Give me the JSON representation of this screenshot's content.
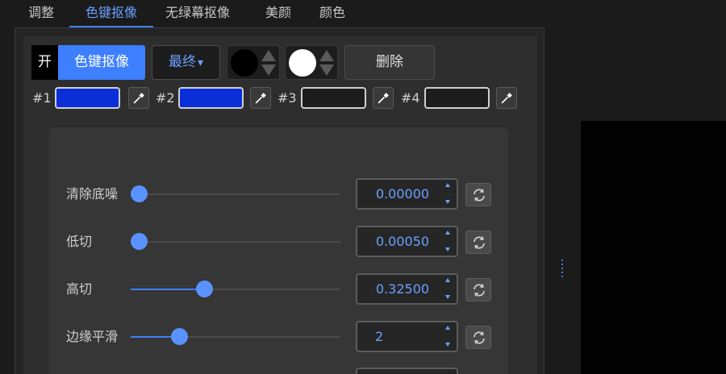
{
  "tabs": [
    {
      "label": "调整"
    },
    {
      "label": "色键抠像"
    },
    {
      "label": "无绿幕抠像"
    },
    {
      "label": "美颜"
    },
    {
      "label": "颜色"
    }
  ],
  "toolbar": {
    "on_label": "开",
    "mode_label": "色键抠像",
    "output_label": "最终",
    "output_arrow": "▾",
    "delete_label": "删除",
    "circle_colors": [
      "#000000",
      "#ffffff"
    ]
  },
  "color_keys": [
    {
      "label": "#1",
      "color": "#0a2fd8"
    },
    {
      "label": "#2",
      "color": "#0a2fd8"
    },
    {
      "label": "#3",
      "color": ""
    },
    {
      "label": "#4",
      "color": ""
    }
  ],
  "sliders": [
    {
      "label": "清除底噪",
      "value": "0.00000",
      "position": 0.04
    },
    {
      "label": "低切",
      "value": "0.00050",
      "position": 0.04
    },
    {
      "label": "高切",
      "value": "0.32500",
      "position": 0.35
    },
    {
      "label": "边缘平滑",
      "value": "2",
      "position": 0.23
    }
  ],
  "colors": {
    "accent": "#3d7fff",
    "accent_text": "#6aa0ff",
    "key_blue": "#0a2fd8"
  }
}
